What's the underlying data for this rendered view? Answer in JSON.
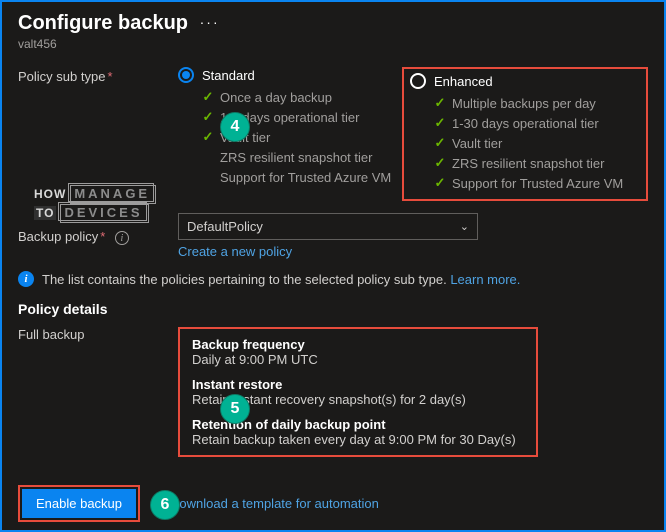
{
  "header": {
    "title": "Configure backup",
    "subtitle": "valt456"
  },
  "policy_sub_type": {
    "label": "Policy sub type",
    "standard": {
      "label": "Standard",
      "features": [
        "Once a day backup",
        "1-5 days operational tier",
        "Vault tier"
      ],
      "unsupported": [
        "ZRS resilient snapshot tier",
        "Support for Trusted Azure VM"
      ]
    },
    "enhanced": {
      "label": "Enhanced",
      "features": [
        "Multiple backups per day",
        "1-30 days operational tier",
        "Vault tier",
        "ZRS resilient snapshot tier",
        "Support for Trusted Azure VM"
      ]
    },
    "selected": "Standard"
  },
  "backup_policy": {
    "label": "Backup policy",
    "value": "DefaultPolicy",
    "create_link": "Create a new policy"
  },
  "info_line": {
    "text": "The list contains the policies pertaining to the selected policy sub type.",
    "learn_more": "Learn more."
  },
  "policy_details": {
    "heading": "Policy details",
    "full_backup_label": "Full backup",
    "frequency": {
      "h": "Backup frequency",
      "v": "Daily at 9:00 PM UTC"
    },
    "instant_restore": {
      "h": "Instant restore",
      "v": "Retain instant recovery snapshot(s) for 2 day(s)"
    },
    "retention": {
      "h": "Retention of daily backup point",
      "v": "Retain backup taken every day at 9:00 PM for 30 Day(s)"
    }
  },
  "footer": {
    "enable": "Enable backup",
    "download": "Download a template for automation"
  },
  "callouts": {
    "c4": "4",
    "c5": "5",
    "c6": "6"
  },
  "watermark": {
    "l1a": "HOW",
    "l1b": "MANAGE",
    "l2a": "TO",
    "l2b": "DEVICES"
  }
}
